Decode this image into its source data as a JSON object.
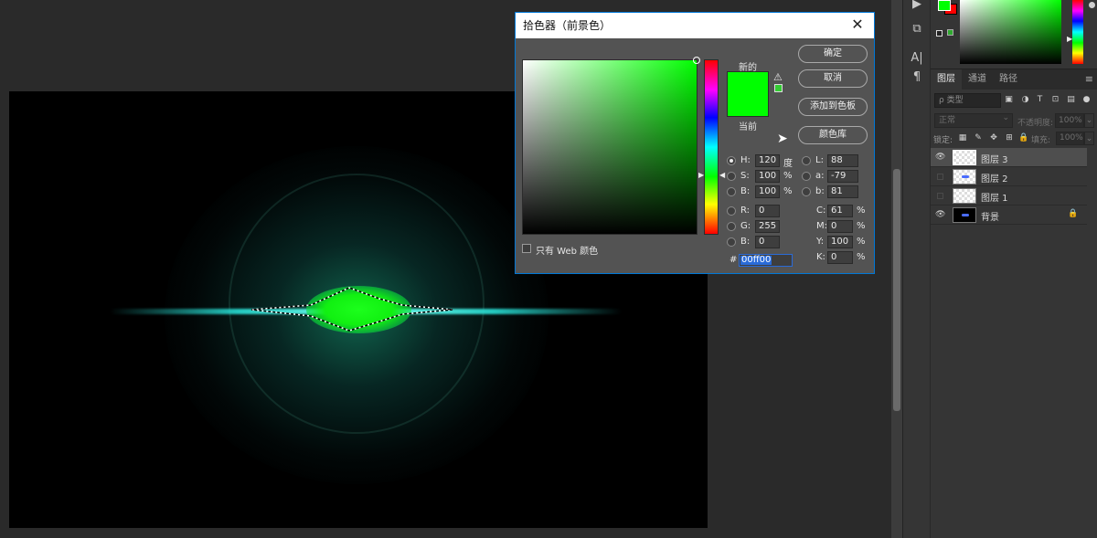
{
  "dialog": {
    "title": "拾色器（前景色）",
    "close": "✕",
    "new_label": "新的",
    "current_label": "当前",
    "buttons": {
      "ok": "确定",
      "cancel": "取消",
      "add_swatch": "添加到色板",
      "libraries": "颜色库"
    },
    "only_web": "只有 Web 颜色",
    "hsb": {
      "h": {
        "label": "H:",
        "value": "120",
        "unit": "度"
      },
      "s": {
        "label": "S:",
        "value": "100",
        "unit": "%"
      },
      "b": {
        "label": "B:",
        "value": "100",
        "unit": "%"
      }
    },
    "rgb": {
      "r": {
        "label": "R:",
        "value": "0"
      },
      "g": {
        "label": "G:",
        "value": "255"
      },
      "b": {
        "label": "B:",
        "value": "0"
      }
    },
    "lab": {
      "l": {
        "label": "L:",
        "value": "88"
      },
      "a": {
        "label": "a:",
        "value": "-79"
      },
      "b": {
        "label": "b:",
        "value": "81"
      }
    },
    "cmyk": {
      "c": {
        "label": "C:",
        "value": "61",
        "unit": "%"
      },
      "m": {
        "label": "M:",
        "value": "0",
        "unit": "%"
      },
      "y": {
        "label": "Y:",
        "value": "100",
        "unit": "%"
      },
      "k": {
        "label": "K:",
        "value": "0",
        "unit": "%"
      }
    },
    "hex_label": "#",
    "hex_value": "00ff00",
    "colors": {
      "new": "#00ff00",
      "current": "#00ff00",
      "accent": "#0078d7"
    }
  },
  "layers_panel": {
    "tabs": [
      "图层",
      "通道",
      "路径"
    ],
    "active_tab": "图层",
    "menu_icon": "≡",
    "filter_placeholder": "ρ 类型",
    "blend_mode": "正常",
    "opacity_label": "不透明度:",
    "opacity_value": "100%",
    "lock_label": "锁定:",
    "fill_label": "填充:",
    "fill_value": "100%",
    "layers": [
      {
        "name": "图层 3",
        "visible": true,
        "selected": true
      },
      {
        "name": "图层 2",
        "visible": false,
        "selected": false
      },
      {
        "name": "图层 1",
        "visible": false,
        "selected": false
      },
      {
        "name": "背景",
        "visible": true,
        "selected": false,
        "locked": true
      }
    ]
  },
  "toolbar": {
    "icons": [
      "play-icon",
      "clone-source-icon",
      "character-icon",
      "paragraph-icon"
    ],
    "glyphs": [
      "▶",
      "⧉",
      "A|",
      "¶"
    ]
  },
  "color_panel": {
    "fg": "#00ff00",
    "bg": "#ff0000"
  }
}
